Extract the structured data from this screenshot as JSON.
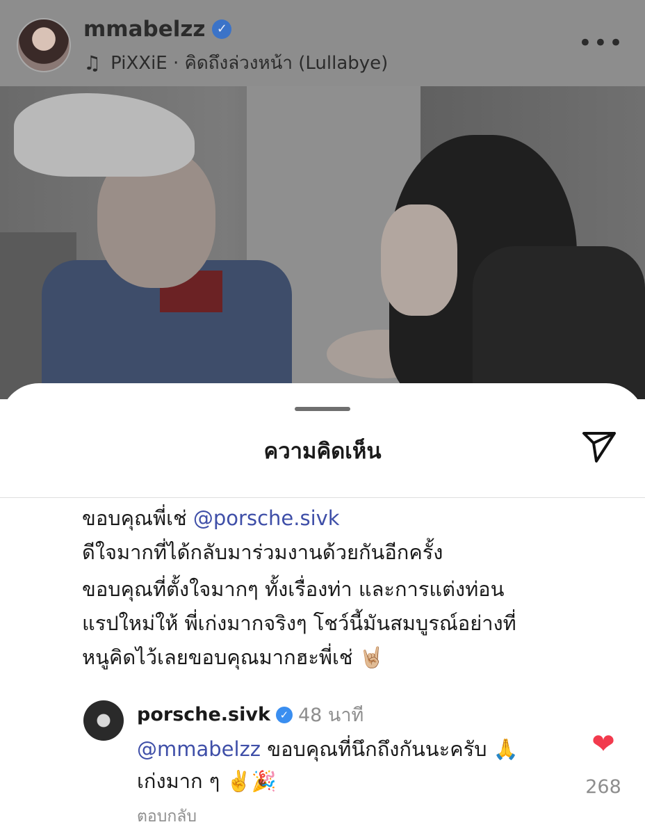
{
  "post": {
    "username": "mmabelzz",
    "music_label": "PiXXiE · คิดถึงล่วงหน้า (Lullabye)"
  },
  "sheet": {
    "title": "ความคิดเห็น",
    "caption_lines": [
      {
        "prefix": "ขอบคุณพี่เช่ ",
        "mention": "@porsche.sivk"
      },
      {
        "text": "ดีใจมากที่ได้กลับมาร่วมงานด้วยกันอีกครั้ง"
      },
      {
        "text": "ขอบคุณที่ตั้งใจมากๆ ทั้งเรื่องท่า และการแต่งท่อน"
      },
      {
        "text": "แรปใหม่ให้ พี่เก่งมากจริงๆ โชว์นี้มันสมบูรณ์อย่างที่"
      },
      {
        "text": "หนูคิดไว้เลยขอบคุณมากฮะพี่เช่ 🤘🏼"
      }
    ]
  },
  "reply": {
    "username": "porsche.sivk",
    "time": "48 นาที",
    "mention": "@mmabelzz",
    "line1": " ขอบคุณที่นึกถึงกันนะครับ 🙏",
    "line2": "เก่งมาก ๆ ✌️🎉",
    "reply_label": "ตอบกลับ",
    "like_count": "268"
  },
  "icons": {
    "verified": "verified-badge-icon",
    "music": "music-note-icon",
    "more": "more-options-icon",
    "send": "send-icon",
    "heart": "heart-icon"
  },
  "colors": {
    "mention": "#3f4fa8",
    "verified": "#3a8ef0",
    "heart": "#f23a4d",
    "muted_text": "#8e8e8e"
  }
}
